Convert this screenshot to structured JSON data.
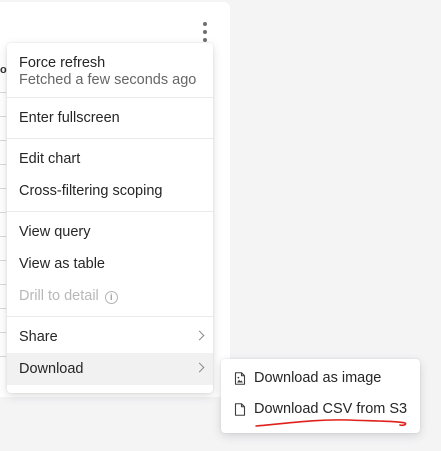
{
  "menu": {
    "force_refresh": "Force refresh",
    "fetched_note": "Fetched a few seconds ago",
    "enter_fullscreen": "Enter fullscreen",
    "edit_chart": "Edit chart",
    "cross_filtering": "Cross-filtering scoping",
    "view_query": "View query",
    "view_as_table": "View as table",
    "drill_to_detail": "Drill to detail",
    "share": "Share",
    "download": "Download"
  },
  "download_submenu": {
    "download_image": "Download as image",
    "download_csv_s3": "Download CSV from S3"
  },
  "icons": {
    "kebab": "more-vertical-icon",
    "info": "info-icon",
    "chevron": "chevron-right-icon",
    "image_file": "file-image-icon",
    "file": "file-icon"
  },
  "colors": {
    "annotation_underline": "#e0211b",
    "active_row": "#f1f1f1",
    "disabled_text": "#b8b8b8"
  }
}
